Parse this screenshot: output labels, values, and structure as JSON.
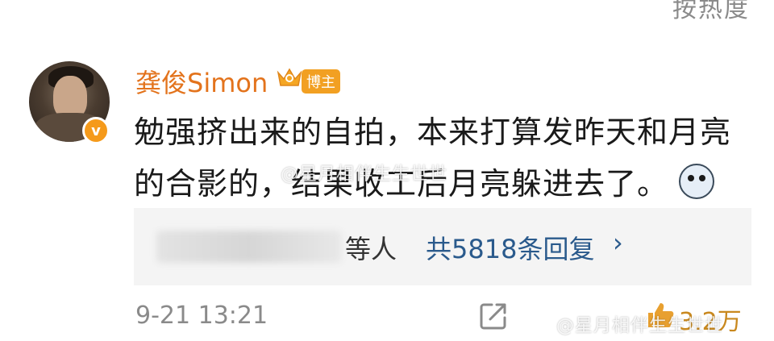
{
  "header": {
    "sort_label": "按热度"
  },
  "comment": {
    "username": "龚俊Simon",
    "badge": "博主",
    "verified_mark": "v",
    "text_line1": "勉强挤出来的自拍，本来打算发昨天和月亮",
    "text_line2": "的合影的，结果收工后月亮躲进去了。",
    "emoji": "husky-emoji",
    "replies": {
      "suffix": "等人",
      "link": "共5818条回复",
      "chevron": "›"
    },
    "timestamp": "9-21 13:21",
    "like_count": "3.2万"
  },
  "watermark": "@星月相伴生生世世",
  "colors": {
    "username": "#e3731c",
    "link": "#2a5a8c",
    "badge_bg": "#f2a022",
    "verified_bg": "#f59a1b"
  }
}
